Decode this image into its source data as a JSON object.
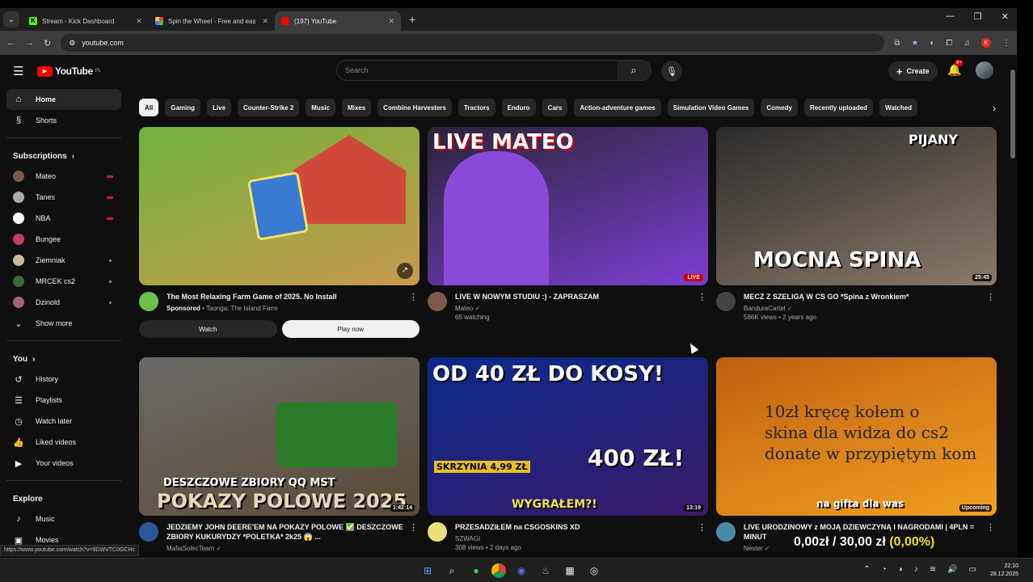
{
  "browser": {
    "tabs": [
      {
        "title": "Stream - Kick Dashboard",
        "favicon_color": "#53fc18",
        "favicon_letter": "K"
      },
      {
        "title": "Spin the Wheel - Free and eas",
        "favicon_color": "#e8a33d",
        "favicon_letter": ""
      },
      {
        "title": "(197) YouTube",
        "favicon_color": "#ff0000",
        "favicon_letter": ""
      }
    ],
    "new_tab": "+",
    "url": "youtube.com",
    "status_url": "https://www.youtube.com/watch?v=9DWVTC0GCHc"
  },
  "header": {
    "logo_text": "YouTube",
    "logo_region": "PL",
    "search_placeholder": "Search",
    "create_label": "Create",
    "notifications_badge": "9+"
  },
  "sidebar": {
    "main": [
      {
        "label": "Home",
        "icon": "home-icon",
        "glyph": "⌂"
      },
      {
        "label": "Shorts",
        "icon": "shorts-icon",
        "glyph": "§"
      }
    ],
    "subscriptions_heading": "Subscriptions",
    "subscriptions": [
      {
        "label": "Mateo",
        "color": "#7a5a4a",
        "status": "live"
      },
      {
        "label": "Tanes",
        "color": "#aaaaaa",
        "status": "live"
      },
      {
        "label": "NBA",
        "color": "#ffffff",
        "status": "live"
      },
      {
        "label": "Bungee",
        "color": "#c04060",
        "status": "none"
      },
      {
        "label": "Ziemniak",
        "color": "#c8b89a",
        "status": "new"
      },
      {
        "label": "MRCEK cs2",
        "color": "#3a6a3a",
        "status": "new"
      },
      {
        "label": "Dzinold",
        "color": "#a06080",
        "status": "new"
      }
    ],
    "show_more": "Show more",
    "you_heading": "You",
    "you_items": [
      {
        "label": "History",
        "icon": "history-icon",
        "glyph": "↺"
      },
      {
        "label": "Playlists",
        "icon": "playlists-icon",
        "glyph": "☰"
      },
      {
        "label": "Watch later",
        "icon": "watch-later-icon",
        "glyph": "◷"
      },
      {
        "label": "Liked videos",
        "icon": "like-icon",
        "glyph": "👍"
      },
      {
        "label": "Your videos",
        "icon": "your-videos-icon",
        "glyph": "▶"
      }
    ],
    "explore_heading": "Explore",
    "explore_items": [
      {
        "label": "Music",
        "icon": "music-icon",
        "glyph": "♪"
      },
      {
        "label": "Movies",
        "icon": "movies-icon",
        "glyph": "▣"
      }
    ]
  },
  "chips": [
    "All",
    "Gaming",
    "Live",
    "Counter-Strike 2",
    "Music",
    "Mixes",
    "Combine Harvesters",
    "Tractors",
    "Enduro",
    "Cars",
    "Action-adventure games",
    "Simulation Video Games",
    "Comedy",
    "Recently uploaded",
    "Watched"
  ],
  "videos": [
    {
      "title": "The Most Relaxing Farm Game of 2025. No Install",
      "line1_prefix": "Sponsored",
      "line1": "Taonga: The Island Farm",
      "line2": "",
      "thumb_text": "",
      "badge": "",
      "ad": true,
      "watch_label": "Watch",
      "play_label": "Play now",
      "thumb_colors": [
        "#6fb23a",
        "#c99a4e"
      ],
      "avatar_color": "#6cc04a"
    },
    {
      "title": "LIVE W NOWYM STUDIU :) - ZAPRASZAM",
      "line1_prefix": "",
      "line1": "Mateo ✓",
      "line2": "65 watching",
      "thumb_text": "LIVE MATEO",
      "badge": "LIVE",
      "ad": false,
      "thumb_colors": [
        "#2a2438",
        "#7a3fd0"
      ],
      "avatar_color": "#7a5a4a"
    },
    {
      "title": "MECZ Z SZELIGĄ W CS GO *Spina z Wronkiem*",
      "line1_prefix": "",
      "line1": "BanduraCartel ✓",
      "line2": "586K views • 2 years ago",
      "thumb_text": "MOCNA SPINA",
      "thumb_text2": "PIJANY",
      "badge": "25:45",
      "ad": false,
      "thumb_colors": [
        "#2b2b2b",
        "#8a7a6a"
      ],
      "avatar_color": "#444444"
    },
    {
      "title": "JEDZIEMY JOHN DEERE'EM NA POKAZY POLOWE ✅ DESZCZOWE ZBIORY KUKURYDZY *POLETKA* 2k25 😱 ...",
      "line1_prefix": "",
      "line1": "MafiaSolecTeam ✓",
      "line2": "",
      "thumb_text": "POKAZY POLOWE 2025",
      "thumb_text2": "DESZCZOWE    ZBIORY QQ     MST",
      "badge": "1:42:14",
      "ad": false,
      "thumb_colors": [
        "#6a6a66",
        "#5a4a3a"
      ],
      "avatar_color": "#2a5a9a"
    },
    {
      "title": "PRZESADZIŁEM na CSGOSKINS XD",
      "line1_prefix": "",
      "line1": "SZWAGI",
      "line2": "308 views • 2 days ago",
      "thumb_text": "OD 40 ZŁ DO KOSY!",
      "thumb_text2": "400 ZŁ!",
      "thumb_text3": "SKRZYNIA 4,99 ZŁ",
      "thumb_text4": "WYGRAŁEM?!",
      "badge": "13:19",
      "ad": false,
      "thumb_colors": [
        "#0a2a8a",
        "#3a1a6a"
      ],
      "avatar_color": "#e8e07a"
    },
    {
      "title": "LIVE URODZINOWY z MOJĄ DZIEWCZYNĄ I NAGRODAMI | 4PLN = MINUT",
      "line1_prefix": "",
      "line1": "Nester ✓",
      "line2": "",
      "thumb_text": "na gifta dla was",
      "badge": "Upcoming",
      "ad": false,
      "thumb_colors": [
        "#c06010",
        "#f0a020"
      ],
      "avatar_color": "#4a8aaa"
    }
  ],
  "overlay": {
    "lines": [
      "10zł kręcę kołem o",
      "skina dla widza do cs2",
      "donate w przypiętym kom"
    ],
    "donate": "0,00zł / 30,00 zł",
    "donate_pct": "(0,00%)"
  },
  "taskbar": {
    "time": "22:10",
    "date": "28.12.2025"
  }
}
